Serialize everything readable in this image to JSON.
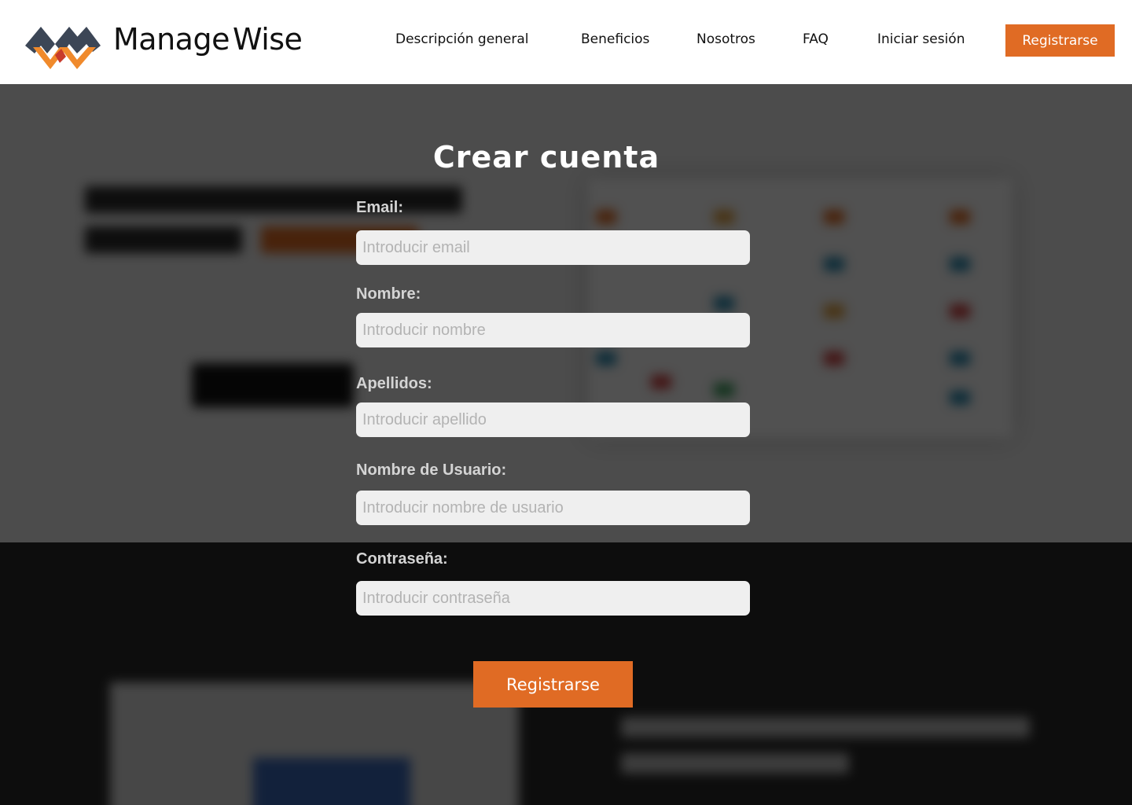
{
  "header": {
    "brand_left": "Manage",
    "brand_right": "Wise",
    "nav": [
      {
        "label": "Descripción general"
      },
      {
        "label": "Beneficios"
      },
      {
        "label": "Nosotros"
      },
      {
        "label": "FAQ"
      },
      {
        "label": "Iniciar sesión"
      }
    ],
    "register_label": "Registrarse"
  },
  "form": {
    "title": "Crear cuenta",
    "fields": [
      {
        "label": "Email:",
        "placeholder": "Introducir email"
      },
      {
        "label": "Nombre:",
        "placeholder": "Introducir nombre"
      },
      {
        "label": "Apellidos:",
        "placeholder": "Introducir apellido"
      },
      {
        "label": "Nombre de Usuario:",
        "placeholder": "Introducir nombre de usuario"
      },
      {
        "label": "Contraseña:",
        "placeholder": "Introducir contraseña"
      }
    ],
    "submit_label": "Registrarse"
  },
  "colors": {
    "accent": "#e06b24",
    "logo_dark": "#3c4656",
    "logo_orange": "#f08a2c",
    "logo_red": "#c83a2a"
  }
}
